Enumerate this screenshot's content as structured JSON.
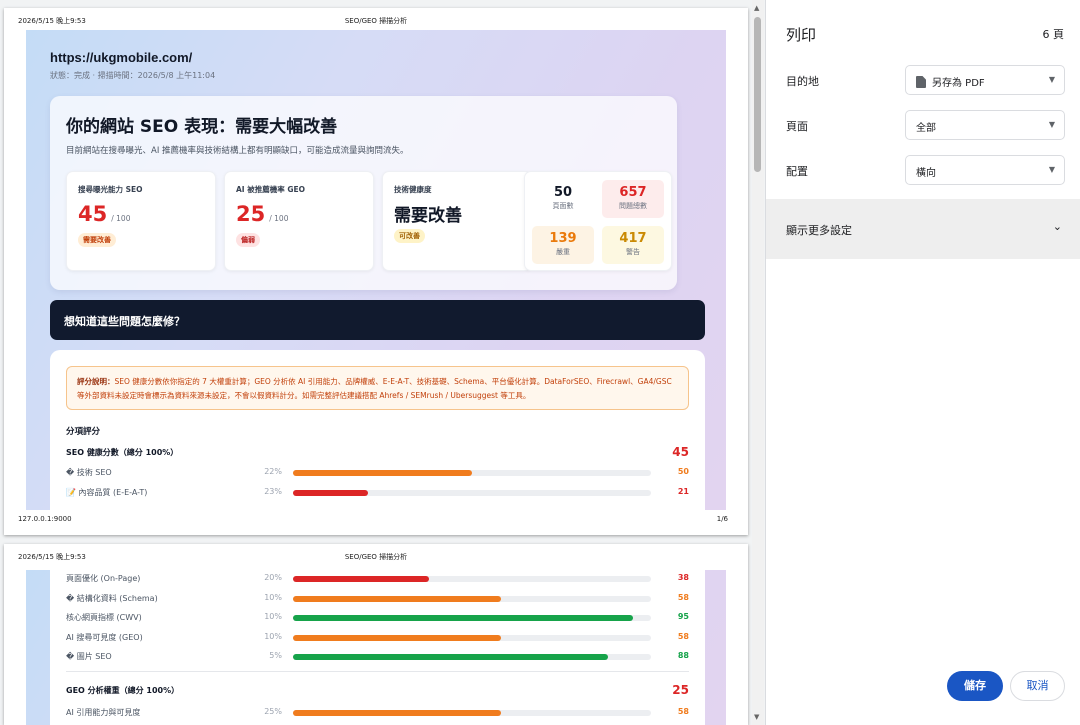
{
  "print_header": {
    "datetime": "2026/5/15 晚上9:53",
    "title": "SEO/GEO 掃描分析"
  },
  "print_footer": {
    "url": "127.0.0.1:9000",
    "page": "1/6"
  },
  "report": {
    "url": "https://ukgmobile.com/",
    "status": "狀態：完成 · 掃描時間：2026/5/8 上午11:04",
    "headline": "你的網站 SEO 表現：需要大幅改善",
    "subtitle": "目前網站在搜尋曝光、AI 推薦機率與技術結構上都有明顯缺口，可能造成流量與詢問流失。",
    "metrics": [
      {
        "label": "搜尋曝光能力 SEO",
        "value": "45",
        "denom": "/ 100",
        "badge": "需要改善",
        "color": "#dc2626",
        "badge_bg": "#ffedd5",
        "badge_color": "#c2410c"
      },
      {
        "label": "AI 被推薦機率 GEO",
        "value": "25",
        "denom": "/ 100",
        "badge": "偏弱",
        "color": "#dc2626",
        "badge_bg": "#fee2e2",
        "badge_color": "#b91c1c"
      },
      {
        "label": "技術健康度",
        "value": "需要改善",
        "badge": "可改善",
        "badge_bg": "#fef3c7",
        "badge_color": "#a16207"
      }
    ],
    "stats": [
      {
        "value": "50",
        "label": "頁面數",
        "color": "#111827",
        "bg": "#ffffff"
      },
      {
        "value": "657",
        "label": "問題總數",
        "color": "#dc2626",
        "bg": "#fdecec"
      },
      {
        "value": "139",
        "label": "嚴重",
        "color": "#ea7a0c",
        "bg": "#fdf3e4"
      },
      {
        "value": "417",
        "label": "警告",
        "color": "#ca8a04",
        "bg": "#fdf8e1"
      }
    ],
    "cta": "想知道這些問題怎麼修？",
    "note_label": "評分說明：",
    "note_text": "SEO 健康分數依你指定的 7 大權重計算；GEO 分析依 AI 引用能力、品牌權威、E-E-A-T、技術基礎、Schema、平台優化計算。DataForSEO、Firecrawl、GA4/GSC 等外部資料未設定時會標示為資料來源未設定，不會以假資料計分。如需完整評估建議搭配 Ahrefs / SEMrush / Ubersuggest 等工具。",
    "breakdown_title": "分項評分",
    "seo_total_label": "SEO 健康分數（總分 100%）",
    "seo_total": "45",
    "geo_total_label": "GEO 分析權重（總分 100%）",
    "geo_total": "25",
    "seo_rows": [
      {
        "name": "� 技術 SEO",
        "weight": "22%",
        "score": 50,
        "color": "#f07c1e"
      },
      {
        "name": "📝 內容品質 (E-E-A-T)",
        "weight": "23%",
        "score": 21,
        "color": "#dc2626"
      },
      {
        "name": "頁面優化 (On-Page)",
        "weight": "20%",
        "score": 38,
        "color": "#dc2626"
      },
      {
        "name": "� 結構化資料 (Schema)",
        "weight": "10%",
        "score": 58,
        "color": "#f07c1e"
      },
      {
        "name": "核心網頁指標 (CWV)",
        "weight": "10%",
        "score": 95,
        "color": "#16a34a"
      },
      {
        "name": "AI 搜尋可見度 (GEO)",
        "weight": "10%",
        "score": 58,
        "color": "#f07c1e"
      },
      {
        "name": "� 圖片 SEO",
        "weight": "5%",
        "score": 88,
        "color": "#16a34a"
      }
    ],
    "geo_rows": [
      {
        "name": "AI 引用能力與可見度",
        "weight": "25%",
        "score": 58,
        "color": "#f07c1e"
      }
    ]
  },
  "panel": {
    "title": "列印",
    "pages": "6 頁",
    "destination_label": "目的地",
    "destination_value": "另存為 PDF",
    "pages_label": "頁面",
    "pages_value": "全部",
    "layout_label": "配置",
    "layout_value": "橫向",
    "more_settings": "顯示更多設定",
    "save": "儲存",
    "cancel": "取消"
  }
}
